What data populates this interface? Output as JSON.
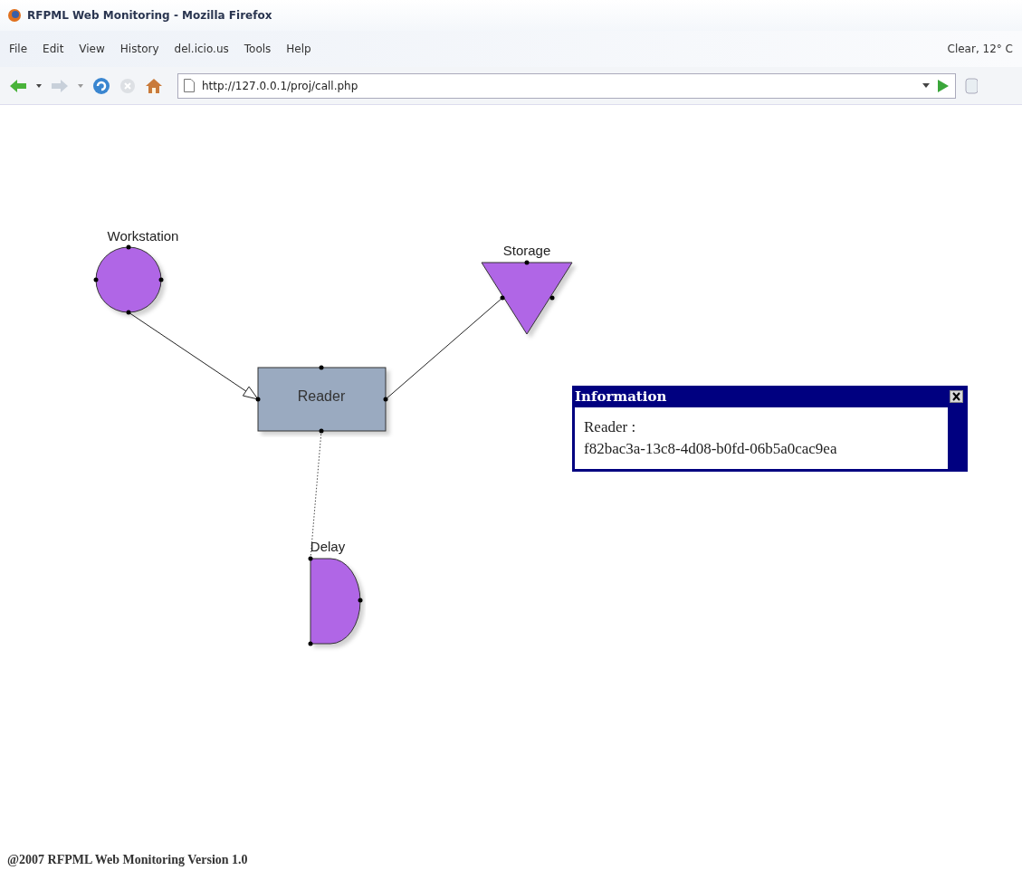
{
  "window": {
    "title": "RFPML Web Monitoring - Mozilla Firefox"
  },
  "menu": [
    "File",
    "Edit",
    "View",
    "History",
    "del.icio.us",
    "Tools",
    "Help"
  ],
  "weather": "Clear, 12° C",
  "address_bar": {
    "value": "http://127.0.0.1/proj/call.php"
  },
  "diagram": {
    "nodes": [
      {
        "kind": "circle",
        "label": "Workstation"
      },
      {
        "kind": "triangle",
        "label": "Storage"
      },
      {
        "kind": "rect",
        "label": "Reader"
      },
      {
        "kind": "delay",
        "label": "Delay"
      }
    ],
    "connectors": [
      {
        "kind": "arrow"
      },
      {
        "kind": "line"
      },
      {
        "kind": "dotted"
      }
    ]
  },
  "info_popup": {
    "title": "Information",
    "lines": [
      "Reader :",
      "f82bac3a-13c8-4d08-b0fd-06b5a0cac9ea"
    ]
  },
  "footer": "@2007 RFPML Web Monitoring Version 1.0"
}
